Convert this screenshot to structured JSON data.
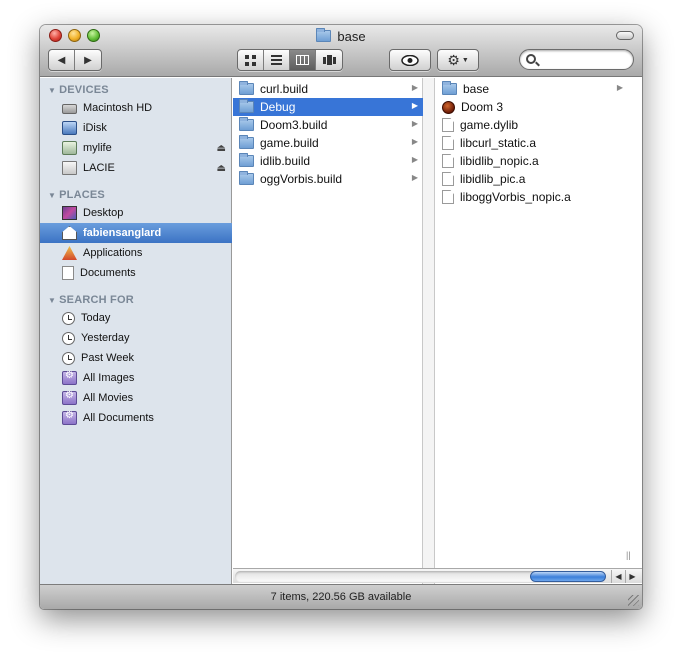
{
  "window": {
    "title": "base",
    "title_icon": "folder-icon"
  },
  "toolbar": {
    "back_label": "◀",
    "forward_label": "▶",
    "view_icons": [
      "icon-view-icon",
      "list-view-icon",
      "column-view-icon",
      "coverflow-view-icon"
    ],
    "active_view": "column",
    "quicklook_icon": "eye-icon",
    "action_icon": "gear-icon",
    "search": {
      "placeholder": "",
      "value": ""
    }
  },
  "sidebar": {
    "sections": [
      {
        "header": "DEVICES",
        "items": [
          {
            "label": "Macintosh HD",
            "icon": "hard-drive-icon",
            "eject": false
          },
          {
            "label": "iDisk",
            "icon": "idisk-icon",
            "eject": false
          },
          {
            "label": "mylife",
            "icon": "disk-image-icon",
            "eject": true
          },
          {
            "label": "LACIE",
            "icon": "external-drive-icon",
            "eject": true
          }
        ]
      },
      {
        "header": "PLACES",
        "items": [
          {
            "label": "Desktop",
            "icon": "desktop-icon"
          },
          {
            "label": "fabiensanglard",
            "icon": "home-icon",
            "selected": true
          },
          {
            "label": "Applications",
            "icon": "applications-icon"
          },
          {
            "label": "Documents",
            "icon": "documents-icon"
          }
        ]
      },
      {
        "header": "SEARCH FOR",
        "items": [
          {
            "label": "Today",
            "icon": "clock-icon"
          },
          {
            "label": "Yesterday",
            "icon": "clock-icon"
          },
          {
            "label": "Past Week",
            "icon": "clock-icon"
          },
          {
            "label": "All Images",
            "icon": "smart-folder-icon"
          },
          {
            "label": "All Movies",
            "icon": "smart-folder-icon"
          },
          {
            "label": "All Documents",
            "icon": "smart-folder-icon"
          }
        ]
      }
    ]
  },
  "columns": [
    {
      "items": [
        {
          "label": "curl.build",
          "type": "folder",
          "has_children": true
        },
        {
          "label": "Debug",
          "type": "folder",
          "has_children": true,
          "selected": true
        },
        {
          "label": "Doom3.build",
          "type": "folder",
          "has_children": true
        },
        {
          "label": "game.build",
          "type": "folder",
          "has_children": true
        },
        {
          "label": "idlib.build",
          "type": "folder",
          "has_children": true
        },
        {
          "label": "oggVorbis.build",
          "type": "folder",
          "has_children": true
        }
      ]
    },
    {
      "items": [
        {
          "label": "base",
          "type": "folder",
          "has_children": true
        },
        {
          "label": "Doom 3",
          "type": "app"
        },
        {
          "label": "game.dylib",
          "type": "file"
        },
        {
          "label": "libcurl_static.a",
          "type": "file"
        },
        {
          "label": "libidlib_nopic.a",
          "type": "file"
        },
        {
          "label": "libidlib_pic.a",
          "type": "file"
        },
        {
          "label": "liboggVorbis_nopic.a",
          "type": "file"
        }
      ]
    }
  ],
  "status": {
    "text": "7 items, 220.56 GB available"
  },
  "colors": {
    "selection": "#3875d7",
    "sidebar_bg": "#dde4ec",
    "sidebar_header": "#7a8796"
  }
}
